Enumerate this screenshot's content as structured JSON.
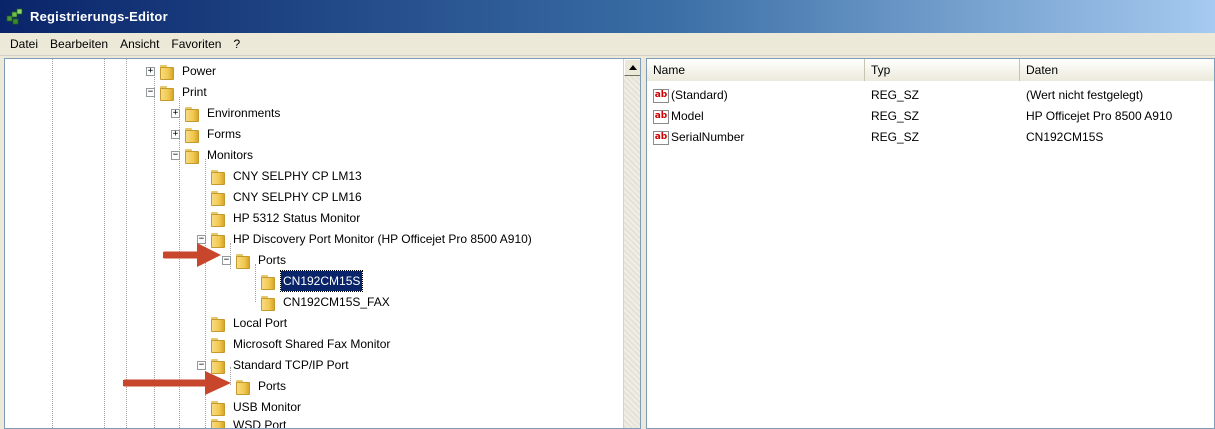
{
  "window": {
    "title": "Registrierungs-Editor"
  },
  "menu": [
    "Datei",
    "Bearbeiten",
    "Ansicht",
    "Favoriten",
    "?"
  ],
  "tree": [
    {
      "label": "Power",
      "expander": "+",
      "selected": false
    },
    {
      "label": "Print",
      "expander": "−",
      "selected": false
    },
    {
      "label": "Environments",
      "expander": "+",
      "selected": false
    },
    {
      "label": "Forms",
      "expander": "+",
      "selected": false
    },
    {
      "label": "Monitors",
      "expander": "−",
      "selected": false
    },
    {
      "label": "CNY SELPHY CP LM13",
      "expander": "",
      "selected": false
    },
    {
      "label": "CNY SELPHY CP LM16",
      "expander": "",
      "selected": false
    },
    {
      "label": "HP 5312 Status Monitor",
      "expander": "",
      "selected": false
    },
    {
      "label": "HP Discovery Port Monitor (HP Officejet Pro 8500 A910)",
      "expander": "−",
      "selected": false
    },
    {
      "label": "Ports",
      "expander": "−",
      "selected": false
    },
    {
      "label": "CN192CM15S",
      "expander": "",
      "selected": true
    },
    {
      "label": "CN192CM15S_FAX",
      "expander": "",
      "selected": false
    },
    {
      "label": "Local Port",
      "expander": "",
      "selected": false
    },
    {
      "label": "Microsoft Shared Fax Monitor",
      "expander": "",
      "selected": false
    },
    {
      "label": "Standard TCP/IP Port",
      "expander": "−",
      "selected": false
    },
    {
      "label": "Ports",
      "expander": "",
      "selected": false
    },
    {
      "label": "USB Monitor",
      "expander": "",
      "selected": false
    },
    {
      "label": "WSD Port",
      "expander": "",
      "selected": false
    }
  ],
  "list": {
    "columns": [
      "Name",
      "Typ",
      "Daten"
    ],
    "rows": [
      {
        "icon": "string-value-icon",
        "name": "(Standard)",
        "type": "REG_SZ",
        "data": "(Wert nicht festgelegt)"
      },
      {
        "icon": "string-value-icon",
        "name": "Model",
        "type": "REG_SZ",
        "data": "HP Officejet Pro 8500 A910"
      },
      {
        "icon": "string-value-icon",
        "name": "SerialNumber",
        "type": "REG_SZ",
        "data": "CN192CM15S"
      }
    ]
  },
  "icons": {
    "ab_text": "ab"
  },
  "colors": {
    "arrow": "#c8462c",
    "selection": "#0a246a",
    "title_start": "#0a246a"
  }
}
